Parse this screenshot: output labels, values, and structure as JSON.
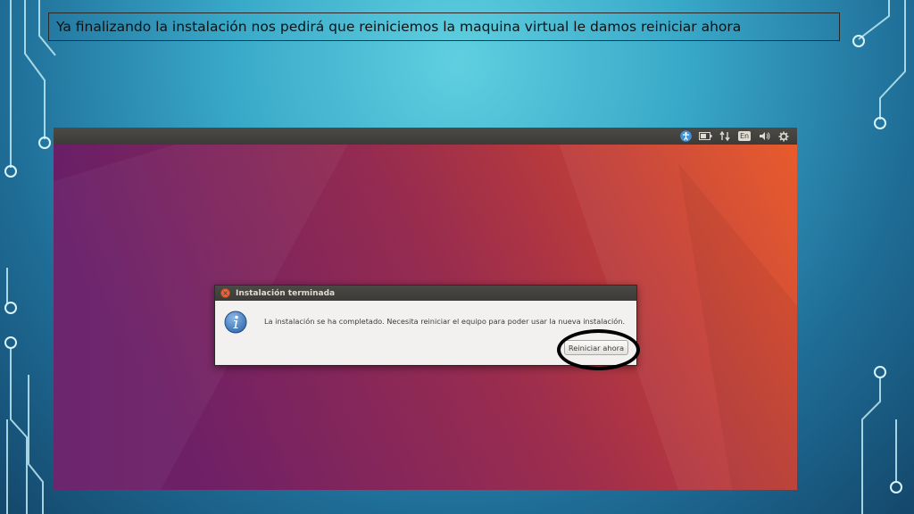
{
  "slide": {
    "caption": "Ya finalizando la instalación nos pedirá que reiniciemos la maquina virtual le damos reiniciar ahora"
  },
  "topbar": {
    "indicators": [
      "accessibility-icon",
      "battery-icon",
      "network-arrows-icon",
      "keyboard-language-indicator",
      "volume-icon",
      "settings-gear-icon"
    ],
    "language": "En"
  },
  "dialog": {
    "title": "Instalación terminada",
    "message": "La instalación se ha completado. Necesita reiniciar el equipo para poder usar la nueva instalación.",
    "button_label": "Reiniciar ahora",
    "icon": "info-icon"
  },
  "colors": {
    "ubuntu_orange": "#e95420",
    "ubuntu_aubergine": "#77216f",
    "panel": "#3c3b37",
    "dialog_bg": "#f2f1f0"
  }
}
